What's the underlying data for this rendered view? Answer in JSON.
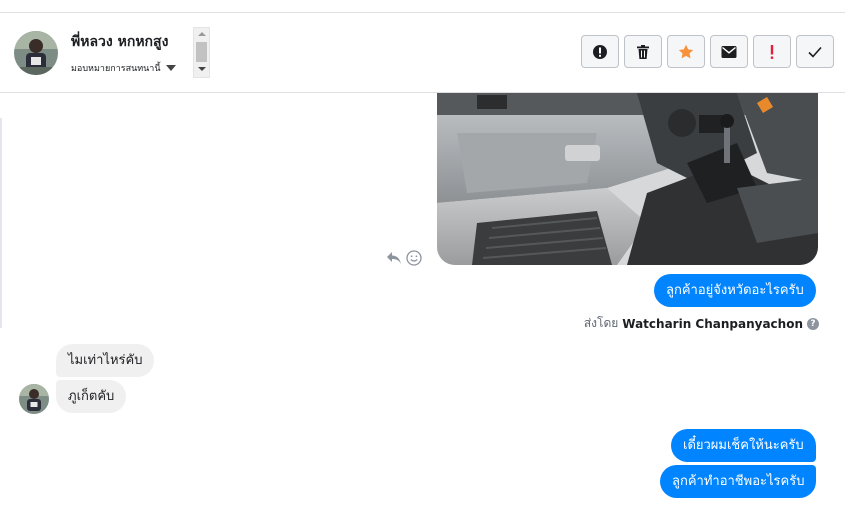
{
  "conversation": {
    "contact_name": "พี่หลวง หกหกสูง",
    "assign_label": "มอบหมายการสนทนานี้"
  },
  "actions": [
    {
      "icon": "alert-circle-icon",
      "tooltip": ""
    },
    {
      "icon": "trash-icon",
      "tooltip": ""
    },
    {
      "icon": "star-icon",
      "tooltip": ""
    },
    {
      "icon": "envelope-icon",
      "tooltip": ""
    },
    {
      "icon": "exclamation-icon",
      "tooltip": ""
    },
    {
      "icon": "checkmark-icon",
      "tooltip": ""
    }
  ],
  "messages": {
    "outgoing_1": "ลูกค้าอยู่จังหวัดอะไรครับ",
    "sent_by_prefix": "ส่งโดย",
    "sent_by_name": "Watcharin Chanpanyachon",
    "help_mark": "?",
    "incoming_1": "ไมเท่าไหร่คับ",
    "incoming_2": "ภูเก็ตคับ",
    "outgoing_2": "เดี๋ยวผมเช็คให้นะครับ",
    "outgoing_3": "ลูกค้าทำอาชีพอะไรครับ"
  },
  "colors": {
    "accent": "#0084ff",
    "star": "#f7923b",
    "alert_red": "#e41e3f",
    "incoming_bg": "#f1f0f0"
  }
}
